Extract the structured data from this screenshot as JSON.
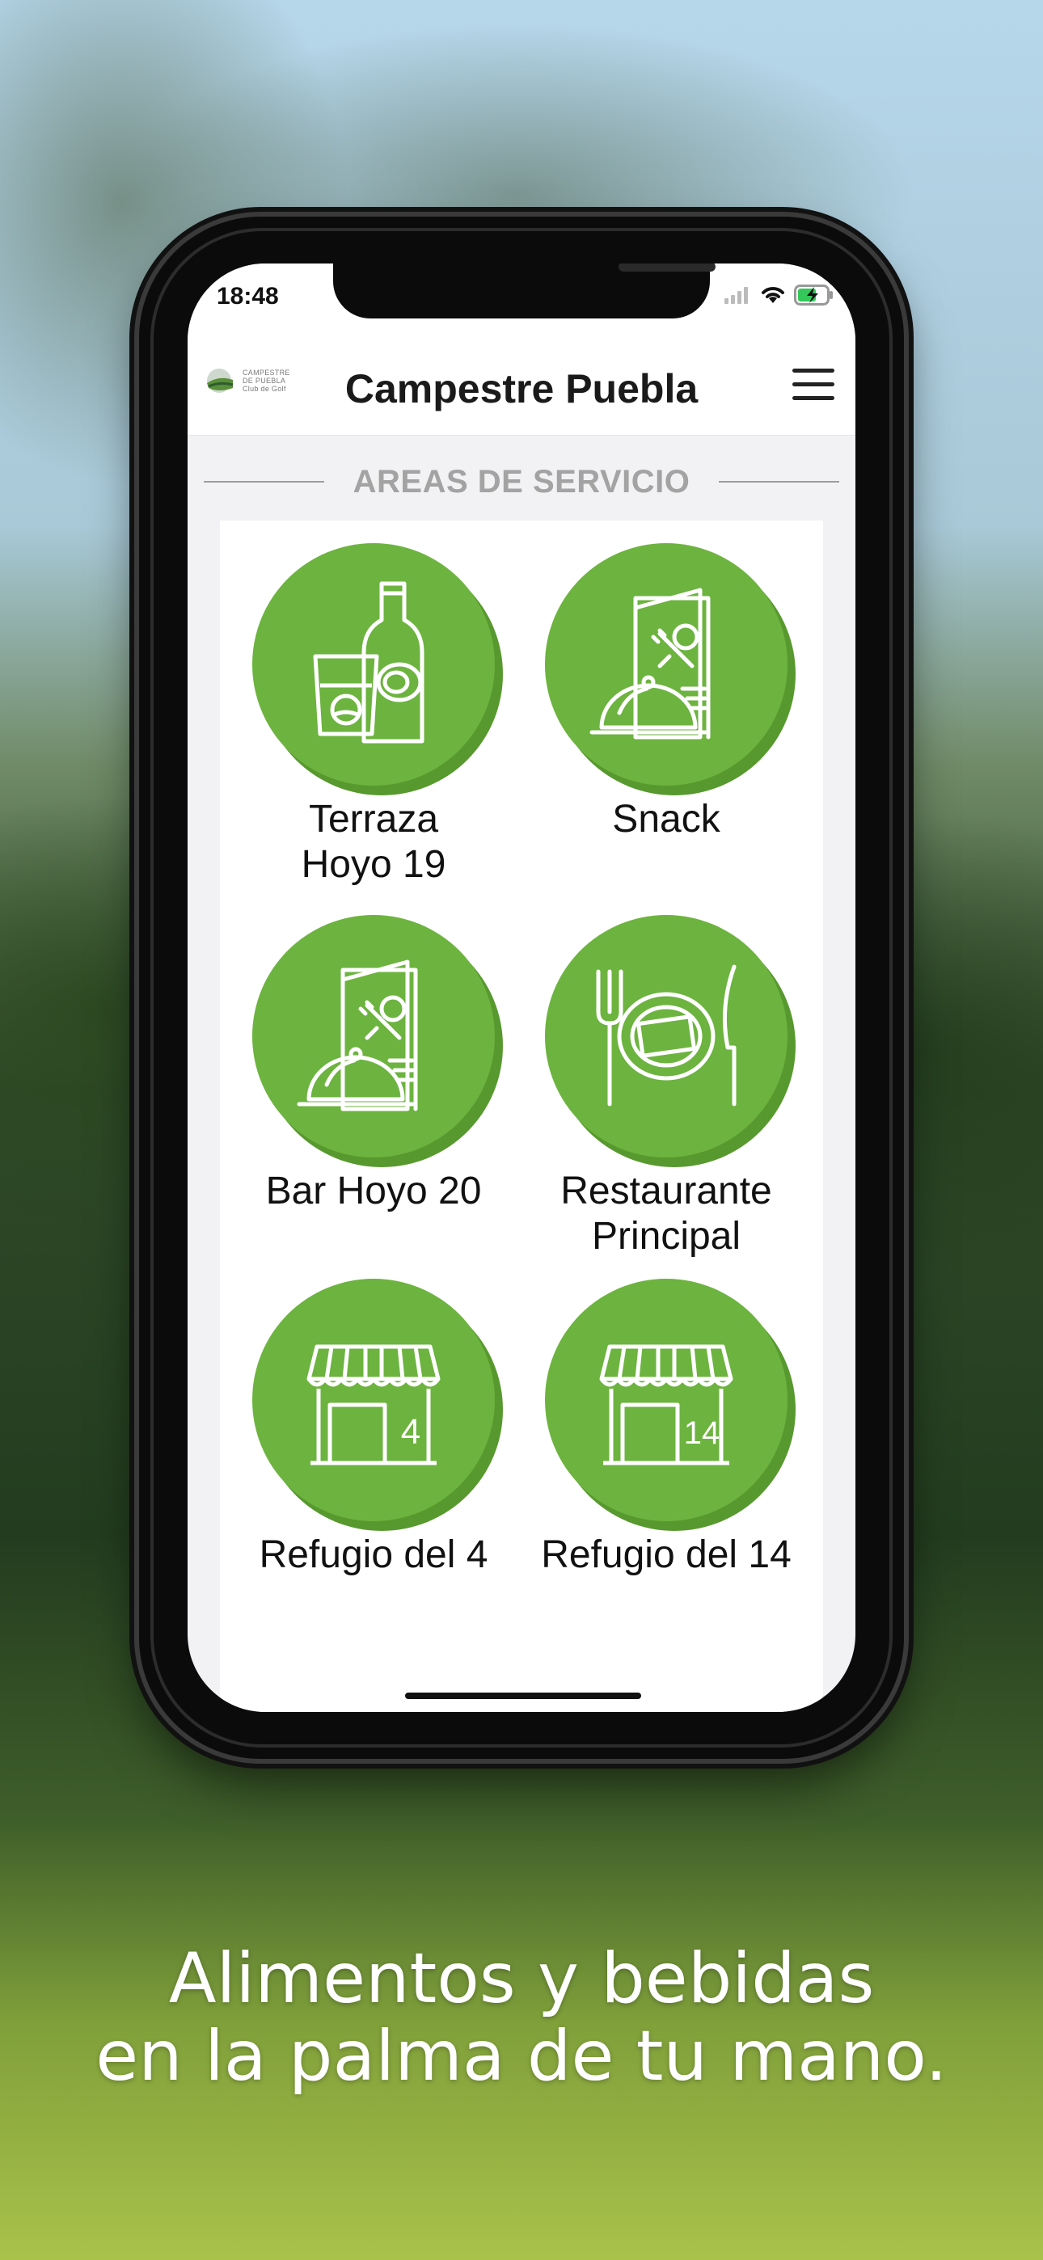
{
  "status_bar": {
    "time": "18:48",
    "signal_icon": "signal-icon",
    "wifi_icon": "wifi-icon",
    "battery_icon": "battery-charging-icon"
  },
  "header": {
    "title": "Campestre Puebla",
    "logo_text": [
      "CAMPESTRE",
      "DE PUEBLA",
      "Club de Golf"
    ],
    "menu_icon": "hamburger-menu-icon"
  },
  "section": {
    "title": "AREAS DE SERVICIO"
  },
  "tiles": [
    {
      "label_lines": [
        "Terraza",
        "Hoyo 19"
      ],
      "icon": "bottle-glass-icon"
    },
    {
      "label_lines": [
        "Snack",
        ""
      ],
      "icon": "menu-cloche-icon"
    },
    {
      "label_lines": [
        "Bar Hoyo 20",
        ""
      ],
      "icon": "menu-cloche-icon"
    },
    {
      "label_lines": [
        "Restaurante",
        "Principal"
      ],
      "icon": "plate-cutlery-icon"
    },
    {
      "label_lines": [
        "Refugio del 4",
        ""
      ],
      "icon": "store-icon",
      "store_number": "4"
    },
    {
      "label_lines": [
        "Refugio del 14",
        ""
      ],
      "icon": "store-icon",
      "store_number": "14"
    }
  ],
  "tagline": {
    "line1": "Alimentos y bebidas",
    "line2": "en la palma de tu mano."
  },
  "colors": {
    "accent_green": "#6db33f",
    "accent_green_shadow": "#57992e",
    "section_title": "#a3a3a3"
  }
}
